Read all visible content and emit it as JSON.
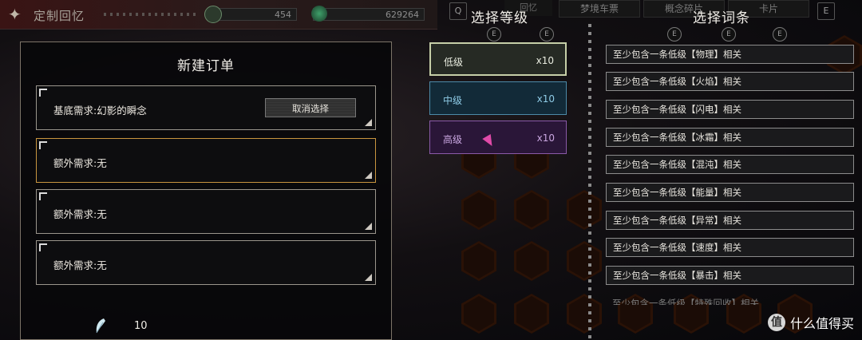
{
  "top_bar": {
    "title": "定制回忆",
    "resource_1": "454",
    "resource_2": "629264"
  },
  "top_tabs": {
    "left_key": "Q",
    "right_key": "E",
    "tabs": [
      "回忆",
      "梦境车票",
      "概念碎片",
      "卡片"
    ]
  },
  "order_panel": {
    "title": "新建订单",
    "base_requirement": "基底需求:幻影的瞬念",
    "cancel_label": "取消选择",
    "extra_requirements": [
      "额外需求:无",
      "额外需求:无",
      "额外需求:无"
    ],
    "currency_count": "10"
  },
  "level_column": {
    "title": "选择等级",
    "levels": [
      {
        "name": "低级",
        "count": "x10"
      },
      {
        "name": "中级",
        "count": "x10"
      },
      {
        "name": "高级",
        "count": "x10"
      }
    ]
  },
  "affix_column": {
    "title": "选择词条",
    "affixes": [
      "至少包含一条低级【物理】相关",
      "至少包含一条低级【火焰】相关",
      "至少包含一条低级【闪电】相关",
      "至少包含一条低级【冰霜】相关",
      "至少包含一条低级【混沌】相关",
      "至少包含一条低级【能量】相关",
      "至少包含一条低级【异常】相关",
      "至少包含一条低级【速度】相关",
      "至少包含一条低级【暴击】相关"
    ],
    "partial_affix": "至少包含一条低级【特殊回收】相关"
  },
  "watermark": {
    "logo_text": "值",
    "text": "什么值得买"
  }
}
